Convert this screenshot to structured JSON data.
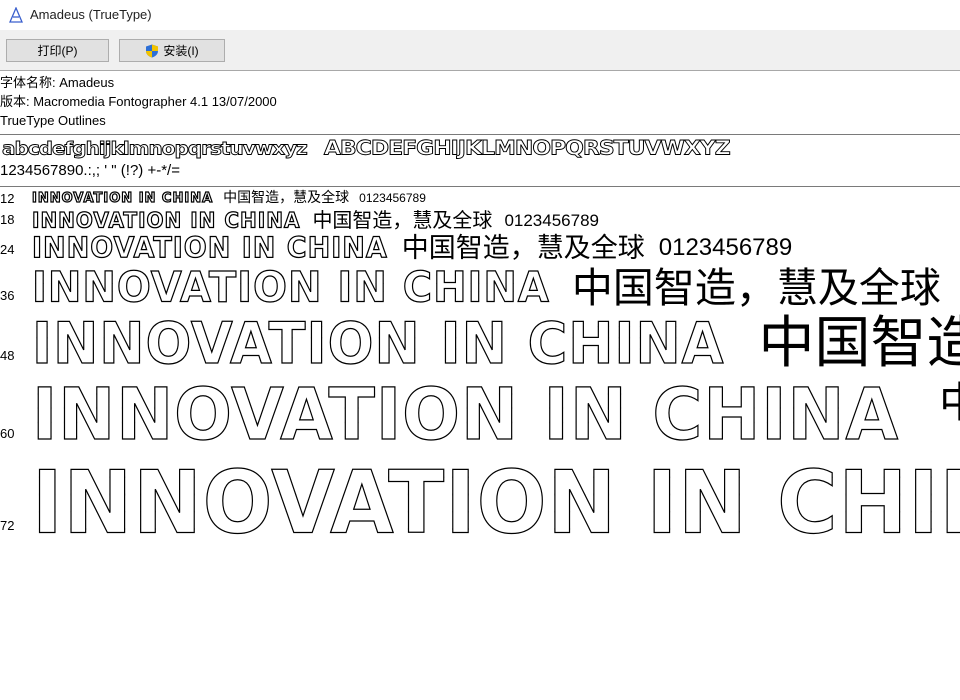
{
  "window": {
    "title": "Amadeus (TrueType)",
    "icon": "font-file-icon"
  },
  "toolbar": {
    "print_label": "打印(P)",
    "install_label": "安装(I)",
    "install_icon": "uac-shield-icon"
  },
  "font_info": {
    "name_line": "字体名称: Amadeus",
    "version_line": "版本: Macromedia Fontographer 4.1 13/07/2000",
    "type_line": "TrueType Outlines"
  },
  "charset": {
    "lowercase": "abcdefghijklmnopqrstuvwxyz",
    "uppercase": "ABCDEFGHIJKLMNOPQRSTUVWXYZ",
    "digits_punct": "1234567890.:,;  '  \"  (!?)  +-*/="
  },
  "sample": {
    "latin": "Innovation in China",
    "cjk": "中国智造，慧及全球",
    "digits": "0123456789"
  },
  "sizes": [
    {
      "label": "12"
    },
    {
      "label": "18"
    },
    {
      "label": "24"
    },
    {
      "label": "36"
    },
    {
      "label": "48"
    },
    {
      "label": "60"
    },
    {
      "label": "72"
    }
  ]
}
